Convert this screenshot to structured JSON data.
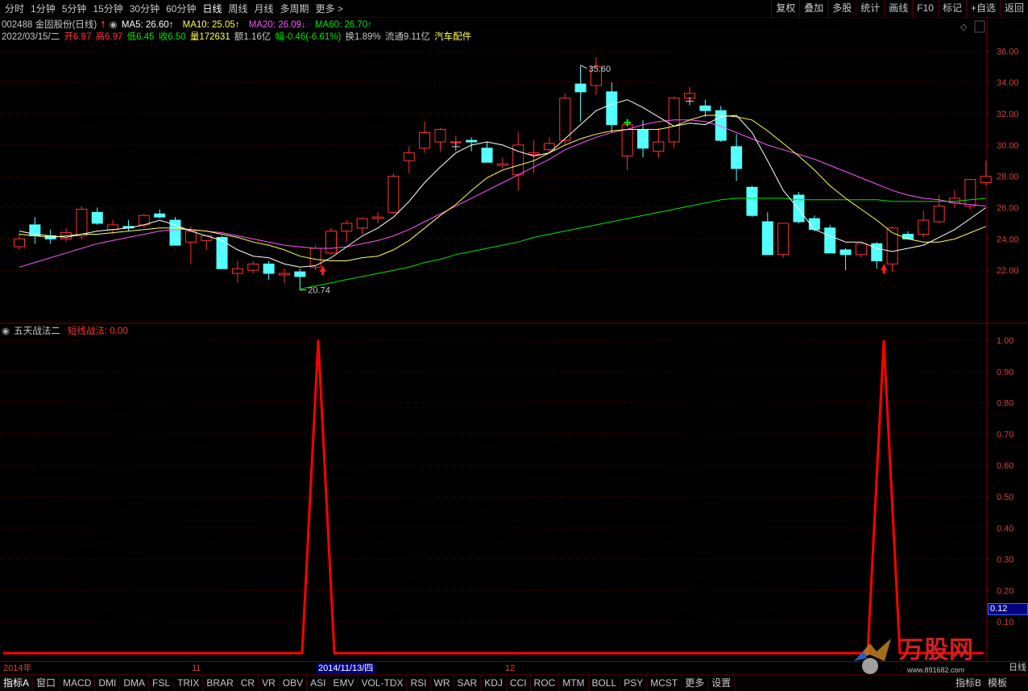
{
  "toolbar": {
    "periods": [
      "分时",
      "1分钟",
      "5分钟",
      "15分钟",
      "30分钟",
      "60分钟",
      "日线",
      "周线",
      "月线",
      "多周期",
      "更多 >"
    ],
    "active_period": "日线",
    "tools": [
      "复权",
      "叠加",
      "多股",
      "统计",
      "画线",
      "F10",
      "标记",
      "+自选",
      "返回"
    ]
  },
  "stock": {
    "code_name": "002488 金固股份(日线)",
    "ma5": "MA5: 26.60↑",
    "ma10": "MA10: 25.05↑",
    "ma20": "MA20: 26.09↓",
    "ma60": "MA60: 26.70↑",
    "date": "2022/03/15/二",
    "open": "开6.97",
    "high": "高6.97",
    "low": "低6.45",
    "close": "收6.50",
    "volume": "量172631",
    "amount": "额1.16亿",
    "change": "幅-0.46(-6.61%)",
    "turnover": "换1.89%",
    "float": "流通9.11亿",
    "sector": "汽车配件"
  },
  "indicator": {
    "name": "五天战法二",
    "line_label": "短线战法: 0.00",
    "value_tag": "0.12"
  },
  "colors": {
    "up": "#ff3232",
    "down": "#54ffff",
    "ma5": "#ffffff",
    "ma10": "#ffff54",
    "ma20": "#ff54ff",
    "ma60": "#00e600",
    "grid": "#7a0000",
    "indicator_line": "#ff0000"
  },
  "axis": {
    "x_labels": [
      "2014年",
      "11",
      "12"
    ],
    "cursor_date": "2014/11/13/四",
    "period_tag": "日线"
  },
  "chart_data": [
    {
      "type": "candlestick",
      "title": "002488 金固股份(日线)",
      "ylim": [
        20,
        37
      ],
      "y_ticks": [
        22.0,
        24.0,
        26.0,
        28.0,
        30.0,
        32.0,
        34.0,
        36.0
      ],
      "annotations": [
        {
          "label": "35.60",
          "kind": "max",
          "bar": 36
        },
        {
          "label": "20.74",
          "kind": "min",
          "bar": 18
        }
      ],
      "candles": [
        {
          "o": 23.5,
          "h": 24.4,
          "l": 23.3,
          "c": 24.0
        },
        {
          "o": 24.9,
          "h": 25.4,
          "l": 23.7,
          "c": 24.2
        },
        {
          "o": 24.2,
          "h": 24.6,
          "l": 23.7,
          "c": 24.0
        },
        {
          "o": 24.0,
          "h": 24.7,
          "l": 23.8,
          "c": 24.4
        },
        {
          "o": 24.2,
          "h": 26.1,
          "l": 24.0,
          "c": 25.9
        },
        {
          "o": 25.7,
          "h": 26.0,
          "l": 24.9,
          "c": 25.0
        },
        {
          "o": 24.6,
          "h": 25.2,
          "l": 24.3,
          "c": 24.9
        },
        {
          "o": 24.8,
          "h": 25.2,
          "l": 24.5,
          "c": 24.7
        },
        {
          "o": 24.9,
          "h": 25.6,
          "l": 24.7,
          "c": 25.5
        },
        {
          "o": 25.6,
          "h": 25.9,
          "l": 25.3,
          "c": 25.4
        },
        {
          "o": 25.2,
          "h": 25.4,
          "l": 23.6,
          "c": 23.6
        },
        {
          "o": 23.8,
          "h": 24.8,
          "l": 22.4,
          "c": 24.5
        },
        {
          "o": 23.9,
          "h": 24.1,
          "l": 23.3,
          "c": 24.2
        },
        {
          "o": 24.1,
          "h": 24.2,
          "l": 22.1,
          "c": 22.1
        },
        {
          "o": 21.8,
          "h": 22.6,
          "l": 21.2,
          "c": 22.1
        },
        {
          "o": 22.0,
          "h": 22.6,
          "l": 21.8,
          "c": 22.4
        },
        {
          "o": 22.4,
          "h": 22.6,
          "l": 21.4,
          "c": 21.8
        },
        {
          "o": 21.7,
          "h": 22.1,
          "l": 21.2,
          "c": 21.8
        },
        {
          "o": 21.9,
          "h": 22.1,
          "l": 20.74,
          "c": 21.6
        },
        {
          "o": 22.2,
          "h": 23.6,
          "l": 22.0,
          "c": 23.4
        },
        {
          "o": 23.1,
          "h": 24.7,
          "l": 23.0,
          "c": 24.5
        },
        {
          "o": 24.5,
          "h": 25.2,
          "l": 23.8,
          "c": 25.0
        },
        {
          "o": 24.7,
          "h": 25.4,
          "l": 24.3,
          "c": 25.3
        },
        {
          "o": 25.3,
          "h": 25.7,
          "l": 25.0,
          "c": 25.4
        },
        {
          "o": 25.7,
          "h": 28.2,
          "l": 25.6,
          "c": 28.0
        },
        {
          "o": 29.0,
          "h": 29.9,
          "l": 28.2,
          "c": 29.5
        },
        {
          "o": 29.8,
          "h": 31.5,
          "l": 29.5,
          "c": 30.8
        },
        {
          "o": 30.2,
          "h": 31.1,
          "l": 29.6,
          "c": 31.0
        },
        {
          "o": 30.2,
          "h": 30.6,
          "l": 29.9,
          "c": 30.2
        },
        {
          "o": 30.3,
          "h": 30.5,
          "l": 29.6,
          "c": 30.2
        },
        {
          "o": 29.8,
          "h": 30.2,
          "l": 28.9,
          "c": 28.9
        },
        {
          "o": 28.7,
          "h": 29.2,
          "l": 28.5,
          "c": 28.8
        },
        {
          "o": 28.1,
          "h": 30.8,
          "l": 27.1,
          "c": 30.0
        },
        {
          "o": 29.4,
          "h": 30.3,
          "l": 28.2,
          "c": 29.5
        },
        {
          "o": 29.7,
          "h": 30.5,
          "l": 29.5,
          "c": 30.1
        },
        {
          "o": 30.3,
          "h": 33.3,
          "l": 30.0,
          "c": 33.0
        },
        {
          "o": 33.9,
          "h": 35.1,
          "l": 31.5,
          "c": 33.4
        },
        {
          "o": 33.8,
          "h": 35.6,
          "l": 33.2,
          "c": 35.0
        },
        {
          "o": 33.4,
          "h": 34.0,
          "l": 30.8,
          "c": 31.3
        },
        {
          "o": 29.3,
          "h": 31.6,
          "l": 28.4,
          "c": 31.3
        },
        {
          "o": 31.0,
          "h": 31.6,
          "l": 29.2,
          "c": 29.8
        },
        {
          "o": 29.6,
          "h": 31.1,
          "l": 29.2,
          "c": 30.2
        },
        {
          "o": 30.2,
          "h": 33.1,
          "l": 29.8,
          "c": 33.0
        },
        {
          "o": 33.0,
          "h": 33.7,
          "l": 32.6,
          "c": 33.3
        },
        {
          "o": 32.5,
          "h": 32.9,
          "l": 31.8,
          "c": 32.2
        },
        {
          "o": 32.2,
          "h": 32.5,
          "l": 30.2,
          "c": 30.3
        },
        {
          "o": 29.9,
          "h": 30.7,
          "l": 27.7,
          "c": 28.5
        },
        {
          "o": 27.3,
          "h": 27.4,
          "l": 25.4,
          "c": 25.5
        },
        {
          "o": 25.1,
          "h": 25.7,
          "l": 23.0,
          "c": 23.0
        },
        {
          "o": 23.0,
          "h": 25.0,
          "l": 22.8,
          "c": 25.0
        },
        {
          "o": 26.8,
          "h": 27.0,
          "l": 25.0,
          "c": 25.1
        },
        {
          "o": 25.3,
          "h": 25.5,
          "l": 24.5,
          "c": 24.6
        },
        {
          "o": 24.7,
          "h": 24.9,
          "l": 23.1,
          "c": 23.1
        },
        {
          "o": 23.3,
          "h": 23.4,
          "l": 22.0,
          "c": 23.0
        },
        {
          "o": 23.0,
          "h": 23.7,
          "l": 22.8,
          "c": 23.7
        },
        {
          "o": 23.7,
          "h": 23.8,
          "l": 22.1,
          "c": 22.6
        },
        {
          "o": 22.4,
          "h": 24.8,
          "l": 21.9,
          "c": 24.7
        },
        {
          "o": 24.3,
          "h": 24.5,
          "l": 24.0,
          "c": 24.0
        },
        {
          "o": 24.3,
          "h": 25.8,
          "l": 24.1,
          "c": 25.2
        },
        {
          "o": 25.1,
          "h": 26.8,
          "l": 25.0,
          "c": 26.1
        },
        {
          "o": 26.3,
          "h": 27.1,
          "l": 26.0,
          "c": 26.6
        },
        {
          "o": 26.1,
          "h": 27.8,
          "l": 25.9,
          "c": 27.8
        },
        {
          "o": 27.6,
          "h": 29.0,
          "l": 27.4,
          "c": 28.0
        }
      ],
      "ma5": [
        24.5,
        24.3,
        24.2,
        24.1,
        24.3,
        24.5,
        24.6,
        24.7,
        24.9,
        25.2,
        24.9,
        24.5,
        24.2,
        23.9,
        23.3,
        22.9,
        22.8,
        22.4,
        22.2,
        22.3,
        22.8,
        23.5,
        24.2,
        24.7,
        25.4,
        26.4,
        27.6,
        28.6,
        29.5,
        30.0,
        30.2,
        30.0,
        29.6,
        29.3,
        29.5,
        30.4,
        31.3,
        32.2,
        32.6,
        32.9,
        32.4,
        31.8,
        31.2,
        31.4,
        31.3,
        31.8,
        31.9,
        30.8,
        29.0,
        27.1,
        25.9,
        24.6,
        24.2,
        23.8,
        23.8,
        23.4,
        23.2,
        23.4,
        23.6,
        24.1,
        24.6,
        25.3,
        26.0
      ],
      "ma10": [
        24.3,
        24.2,
        24.1,
        24.2,
        24.3,
        24.3,
        24.4,
        24.5,
        24.6,
        24.7,
        24.7,
        24.6,
        24.5,
        24.3,
        24.1,
        23.8,
        23.6,
        23.3,
        22.9,
        22.7,
        22.6,
        22.6,
        22.8,
        22.9,
        23.3,
        23.9,
        24.7,
        25.5,
        26.2,
        27.1,
        27.9,
        28.4,
        28.7,
        29.0,
        29.5,
        30.0,
        30.4,
        30.7,
        30.9,
        31.0,
        31.0,
        31.0,
        31.2,
        31.6,
        31.9,
        31.9,
        31.8,
        31.6,
        30.9,
        30.1,
        29.3,
        28.4,
        27.4,
        26.6,
        25.9,
        25.2,
        24.4,
        24.0,
        23.8,
        23.8,
        24.0,
        24.4,
        24.8
      ],
      "ma20": [
        22.2,
        22.5,
        22.8,
        23.1,
        23.4,
        23.7,
        23.9,
        24.1,
        24.3,
        24.5,
        24.6,
        24.6,
        24.5,
        24.4,
        24.2,
        24.0,
        23.8,
        23.6,
        23.5,
        23.4,
        23.4,
        23.5,
        23.7,
        23.9,
        24.2,
        24.6,
        25.1,
        25.6,
        26.1,
        26.6,
        27.1,
        27.6,
        28.1,
        28.6,
        29.1,
        29.7,
        30.1,
        30.5,
        30.8,
        31.0,
        31.3,
        31.5,
        31.6,
        31.6,
        31.5,
        31.2,
        30.8,
        30.4,
        30.0,
        29.7,
        29.4,
        29.1,
        28.7,
        28.3,
        27.9,
        27.5,
        27.1,
        26.8,
        26.6,
        26.5,
        26.3,
        26.2,
        26.1
      ],
      "ma60_start_bar": 18,
      "ma60": [
        20.8,
        21.0,
        21.2,
        21.4,
        21.6,
        21.8,
        22.0,
        22.2,
        22.5,
        22.7,
        23.0,
        23.2,
        23.4,
        23.6,
        23.8,
        24.1,
        24.3,
        24.5,
        24.7,
        24.9,
        25.1,
        25.3,
        25.5,
        25.7,
        25.9,
        26.1,
        26.3,
        26.5,
        26.6,
        26.6,
        26.6,
        26.6,
        26.5,
        26.5,
        26.5,
        26.5,
        26.5,
        26.5,
        26.4,
        26.4,
        26.4,
        26.4,
        26.4,
        26.5,
        26.6
      ]
    },
    {
      "type": "line",
      "title": "五天战法二",
      "series": [
        {
          "name": "短线战法",
          "spikes_at_bars": [
            19,
            55
          ],
          "baseline": 0.0,
          "peak": 1.0
        }
      ],
      "ylim": [
        0,
        1.1
      ],
      "y_ticks": [
        0.1,
        0.2,
        0.3,
        0.4,
        0.5,
        0.6,
        0.7,
        0.8,
        0.9,
        1.0
      ]
    }
  ],
  "bottom_tabs": [
    "指标A",
    "窗口",
    "MACD",
    "DMI",
    "DMA",
    "FSL",
    "TRIX",
    "BRAR",
    "CR",
    "VR",
    "OBV",
    "ASI",
    "EMV",
    "VOL-TDX",
    "RSI",
    "WR",
    "SAR",
    "KDJ",
    "CCI",
    "ROC",
    "MTM",
    "BOLL",
    "PSY",
    "MCST",
    "更多",
    "设置"
  ],
  "bottom_right": [
    "指标B",
    "模板"
  ],
  "watermark": {
    "text": "万股网",
    "sub": "www.891682.com"
  }
}
